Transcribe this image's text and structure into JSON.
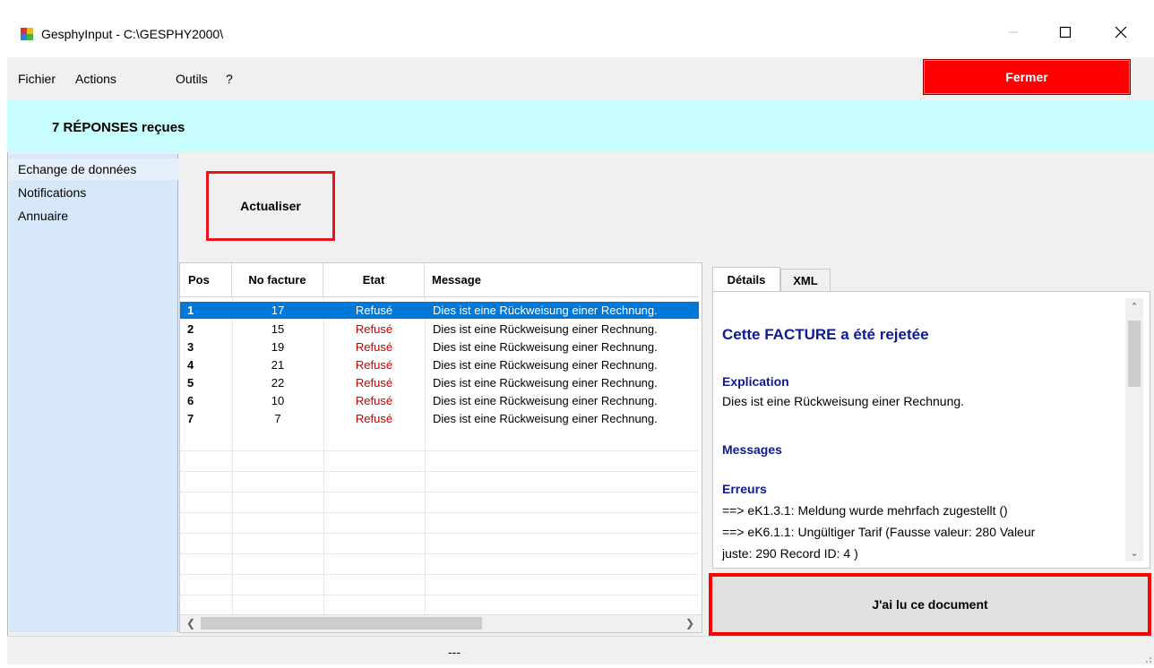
{
  "window": {
    "title": "GesphyInput - C:\\GESPHY2000\\",
    "app_icon": "app-window-icon",
    "controls": [
      "minimize-icon",
      "maximize-icon",
      "close-icon"
    ]
  },
  "menu": {
    "items": [
      "Fichier",
      "Actions",
      "Outils",
      "?"
    ],
    "fermer_label": "Fermer"
  },
  "banner": {
    "text": "7 RÉPONSES reçues"
  },
  "sidebar": {
    "items": [
      "Echange de données",
      "Notifications",
      "Annuaire"
    ]
  },
  "toolbar": {
    "actualiser_label": "Actualiser"
  },
  "grid": {
    "columns": [
      "Pos",
      "No facture",
      "Etat",
      "Message"
    ],
    "rows": [
      {
        "pos": "1",
        "no_facture": "17",
        "etat": "Refusé",
        "message": "Dies ist eine Rückweisung einer Rechnung."
      },
      {
        "pos": "2",
        "no_facture": "15",
        "etat": "Refusé",
        "message": "Dies ist eine Rückweisung einer Rechnung."
      },
      {
        "pos": "3",
        "no_facture": "19",
        "etat": "Refusé",
        "message": "Dies ist eine Rückweisung einer Rechnung."
      },
      {
        "pos": "4",
        "no_facture": "21",
        "etat": "Refusé",
        "message": "Dies ist eine Rückweisung einer Rechnung."
      },
      {
        "pos": "5",
        "no_facture": "22",
        "etat": "Refusé",
        "message": "Dies ist eine Rückweisung einer Rechnung."
      },
      {
        "pos": "6",
        "no_facture": "10",
        "etat": "Refusé",
        "message": "Dies ist eine Rückweisung einer Rechnung."
      },
      {
        "pos": "7",
        "no_facture": "7",
        "etat": "Refusé",
        "message": "Dies ist eine Rückweisung einer Rechnung."
      }
    ],
    "selected_row": 1
  },
  "details": {
    "tabs": [
      "Détails",
      "XML"
    ],
    "heading": "Cette FACTURE a été rejetée",
    "explication_label": "Explication",
    "explication_text": "Dies ist eine Rückweisung einer Rechnung.",
    "messages_label": "Messages",
    "erreurs_label": "Erreurs",
    "erreurs": [
      "==> eK1.3.1: Meldung wurde mehrfach zugestellt ()",
      "==> eK6.1.1: Ungültiger Tarif (Fausse valeur: 280 Valeur",
      "juste: 290 Record ID: 4 )"
    ],
    "jailu_label": "J'ai lu ce document"
  },
  "statusbar": {
    "text": "---"
  },
  "colors": {
    "fermer_bg": "#ff0000",
    "banner_bg": "#c8fdfe",
    "sidebar_bg": "#d7e8fb",
    "selection": "#0078d7",
    "etat_refuse": "#c00000",
    "details_heading": "#0f1a8f",
    "highlight_border": "#e8131c"
  }
}
